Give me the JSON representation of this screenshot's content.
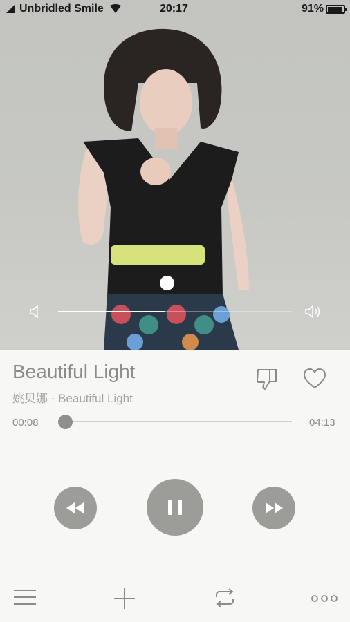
{
  "status_bar": {
    "carrier": "Unbridled Smile",
    "time": "20:17",
    "battery_percent": "91%",
    "battery_level": 0.91
  },
  "album_art": {
    "description_icon": "album-art-photo"
  },
  "volume": {
    "level": 0.46,
    "low_icon": "volume-low-icon",
    "high_icon": "volume-high-icon"
  },
  "song": {
    "title": "Beautiful Light",
    "subtitle": "姚贝娜 - Beautiful Light"
  },
  "progress": {
    "elapsed": "00:08",
    "total": "04:13",
    "fraction": 0.03
  },
  "controls": {
    "prev_icon": "rewind-icon",
    "play_icon": "pause-icon",
    "next_icon": "fast-forward-icon"
  },
  "toolbar": {
    "menu_icon": "menu-icon",
    "add_icon": "plus-icon",
    "repeat_icon": "repeat-icon",
    "more_icon": "more-icon"
  },
  "colors": {
    "accent_gray": "#9c9c98",
    "text_gray": "#8b8b87",
    "background": "#f7f8f6"
  }
}
